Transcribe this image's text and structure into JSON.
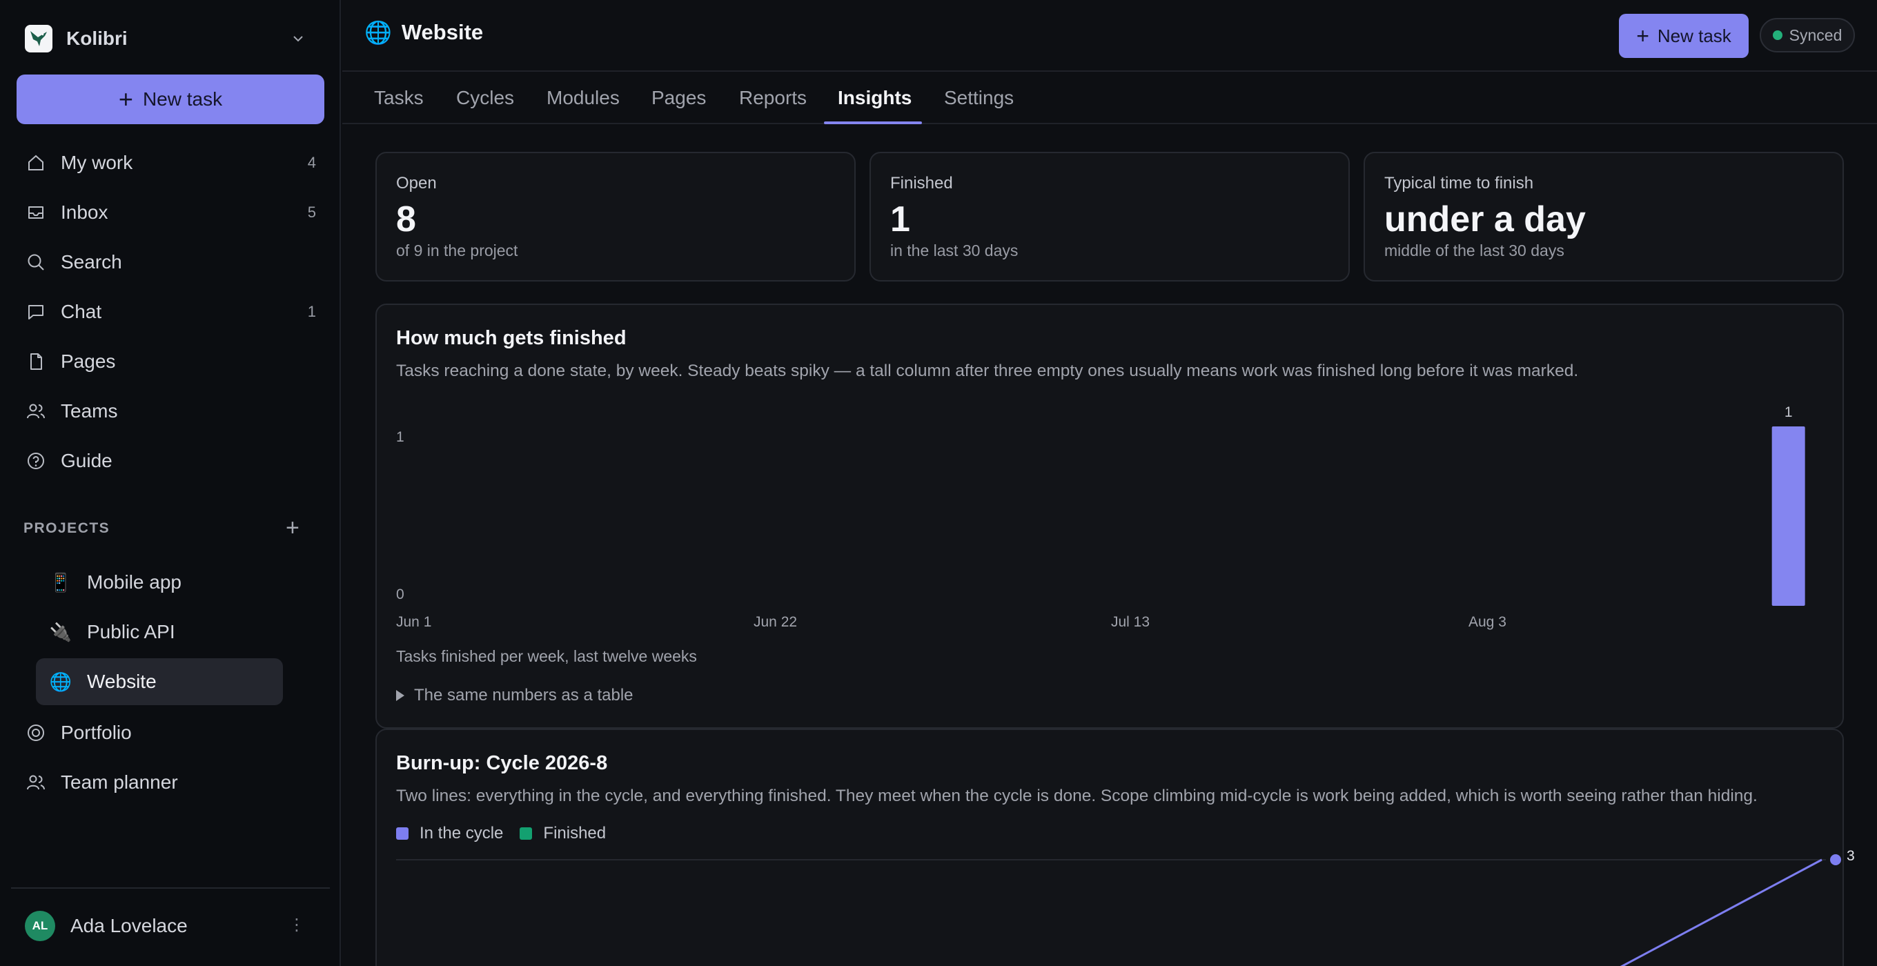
{
  "workspace": {
    "name": "Kolibri"
  },
  "sidebar": {
    "new_task": "New task",
    "items": [
      {
        "label": "My work",
        "count": "4",
        "icon": "home-icon"
      },
      {
        "label": "Inbox",
        "count": "5",
        "icon": "inbox-icon"
      },
      {
        "label": "Search",
        "count": "",
        "icon": "search-icon"
      },
      {
        "label": "Chat",
        "count": "1",
        "icon": "chat-icon"
      },
      {
        "label": "Pages",
        "count": "",
        "icon": "page-icon"
      },
      {
        "label": "Teams",
        "count": "",
        "icon": "teams-icon"
      },
      {
        "label": "Guide",
        "count": "",
        "icon": "help-icon"
      }
    ],
    "projects_heading": "PROJECTS",
    "projects": [
      {
        "emoji": "📱",
        "label": "Mobile app"
      },
      {
        "emoji": "🔌",
        "label": "Public API"
      },
      {
        "emoji": "🌐",
        "label": "Website"
      }
    ],
    "extra_items": [
      {
        "label": "Portfolio",
        "icon": "target-icon"
      },
      {
        "label": "Team planner",
        "icon": "people-icon"
      }
    ],
    "user": {
      "initials": "AL",
      "name": "Ada Lovelace",
      "more": "⋮"
    }
  },
  "header": {
    "emoji": "🌐",
    "title": "Website",
    "new_task": "New task",
    "sync_status": "Synced"
  },
  "tabs": [
    "Tasks",
    "Cycles",
    "Modules",
    "Pages",
    "Reports",
    "Insights",
    "Settings"
  ],
  "active_tab": "Insights",
  "stats": [
    {
      "label": "Open",
      "value": "8",
      "sub": "of 9 in the project"
    },
    {
      "label": "Finished",
      "value": "1",
      "sub": "in the last 30 days"
    },
    {
      "label": "Typical time to finish",
      "value": "under a day",
      "sub": "middle of the last 30 days"
    }
  ],
  "finished_section": {
    "title": "How much gets finished",
    "description": "Tasks reaching a done state, by week. Steady beats spiky — a tall column after three empty ones usually means work was finished long before it was marked.",
    "caption": "Tasks finished per week, last twelve weeks",
    "table_toggle": "The same numbers as a table"
  },
  "burnup_section": {
    "title": "Burn-up: Cycle 2026-8",
    "description": "Two lines: everything in the cycle, and everything finished. They meet when the cycle is done. Scope climbing mid-cycle is work being added, which is worth seeing rather than hiding.",
    "legend": [
      {
        "label": "In the cycle",
        "color": "#7d7ef0"
      },
      {
        "label": "Finished",
        "color": "#13a070"
      }
    ]
  },
  "chart_data": [
    {
      "type": "bar",
      "categories": [
        "Jun 1",
        "Jun 8",
        "Jun 15",
        "Jun 22",
        "Jun 29",
        "Jul 6",
        "Jul 13",
        "Jul 20",
        "Jul 27",
        "Aug 3",
        "Aug 10",
        "Aug 17"
      ],
      "tick_labels": [
        "Jun 1",
        "Jun 22",
        "Jul 13",
        "Aug 3"
      ],
      "values": [
        0,
        0,
        0,
        0,
        0,
        0,
        0,
        0,
        0,
        0,
        0,
        1
      ],
      "ylim": [
        0,
        1
      ],
      "y_ticks": [
        "0",
        "1"
      ],
      "color": "#8485f0"
    },
    {
      "type": "line",
      "series": [
        {
          "name": "In the cycle",
          "color": "#7d7ef0",
          "last_value": 3,
          "last_label": "3"
        }
      ]
    }
  ]
}
